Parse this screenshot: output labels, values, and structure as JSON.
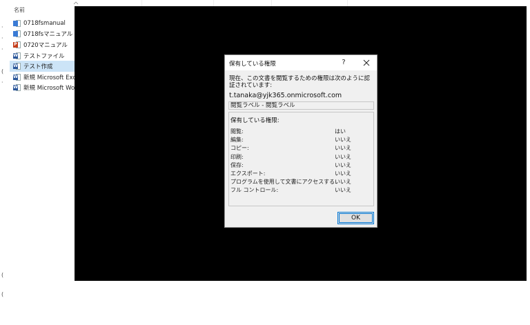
{
  "explorer": {
    "column_header": "名前",
    "left_edge_glyphs": [
      "·",
      "·",
      "·",
      "(",
      "·",
      "(",
      "("
    ],
    "files": [
      {
        "name": "0718fsmanual",
        "icon": "mp4-video-icon",
        "color": "#3a7bd5",
        "badge": "",
        "selected": false
      },
      {
        "name": "0718fsマニュアル",
        "icon": "mp4-video-icon",
        "color": "#3a7bd5",
        "badge": "",
        "selected": false
      },
      {
        "name": "0720マニュアル",
        "icon": "powerpoint-file-icon",
        "color": "#c43e1c",
        "badge": "P",
        "selected": false
      },
      {
        "name": "テストファイル",
        "icon": "word-protected-file-icon",
        "color": "#2b579a",
        "badge": "W",
        "selected": false
      },
      {
        "name": "テスト作成",
        "icon": "word-protected-file-icon",
        "color": "#2b579a",
        "badge": "W",
        "selected": true
      },
      {
        "name": "新規 Microsoft Exce",
        "icon": "word-protected-file-icon",
        "color": "#2b579a",
        "badge": "W",
        "selected": false
      },
      {
        "name": "新規 Microsoft Wor",
        "icon": "word-protected-file-icon",
        "color": "#2b579a",
        "badge": "W",
        "selected": false
      }
    ]
  },
  "dialog": {
    "title": "保有している権限",
    "help_label": "?",
    "intro": "現在、この文書を閲覧するための権限は次のように認証されています:",
    "email": "t.tanaka@yjk365.onmicrosoft.com",
    "label": "閲覧ラベル - 閲覧ラベル",
    "permissions_heading": "保有している権限:",
    "permissions": [
      {
        "name": "閲覧:",
        "value": "はい"
      },
      {
        "name": "編集:",
        "value": "いいえ"
      },
      {
        "name": "コピー:",
        "value": "いいえ"
      },
      {
        "name": "印刷:",
        "value": "いいえ"
      },
      {
        "name": "保存:",
        "value": "いいえ"
      },
      {
        "name": "エクスポート:",
        "value": "いいえ"
      },
      {
        "name": "プログラムを使用して文書にアクセスする:",
        "value": "いいえ"
      },
      {
        "name": "フル コントロール:",
        "value": "いいえ"
      }
    ],
    "ok_label": "OK"
  }
}
